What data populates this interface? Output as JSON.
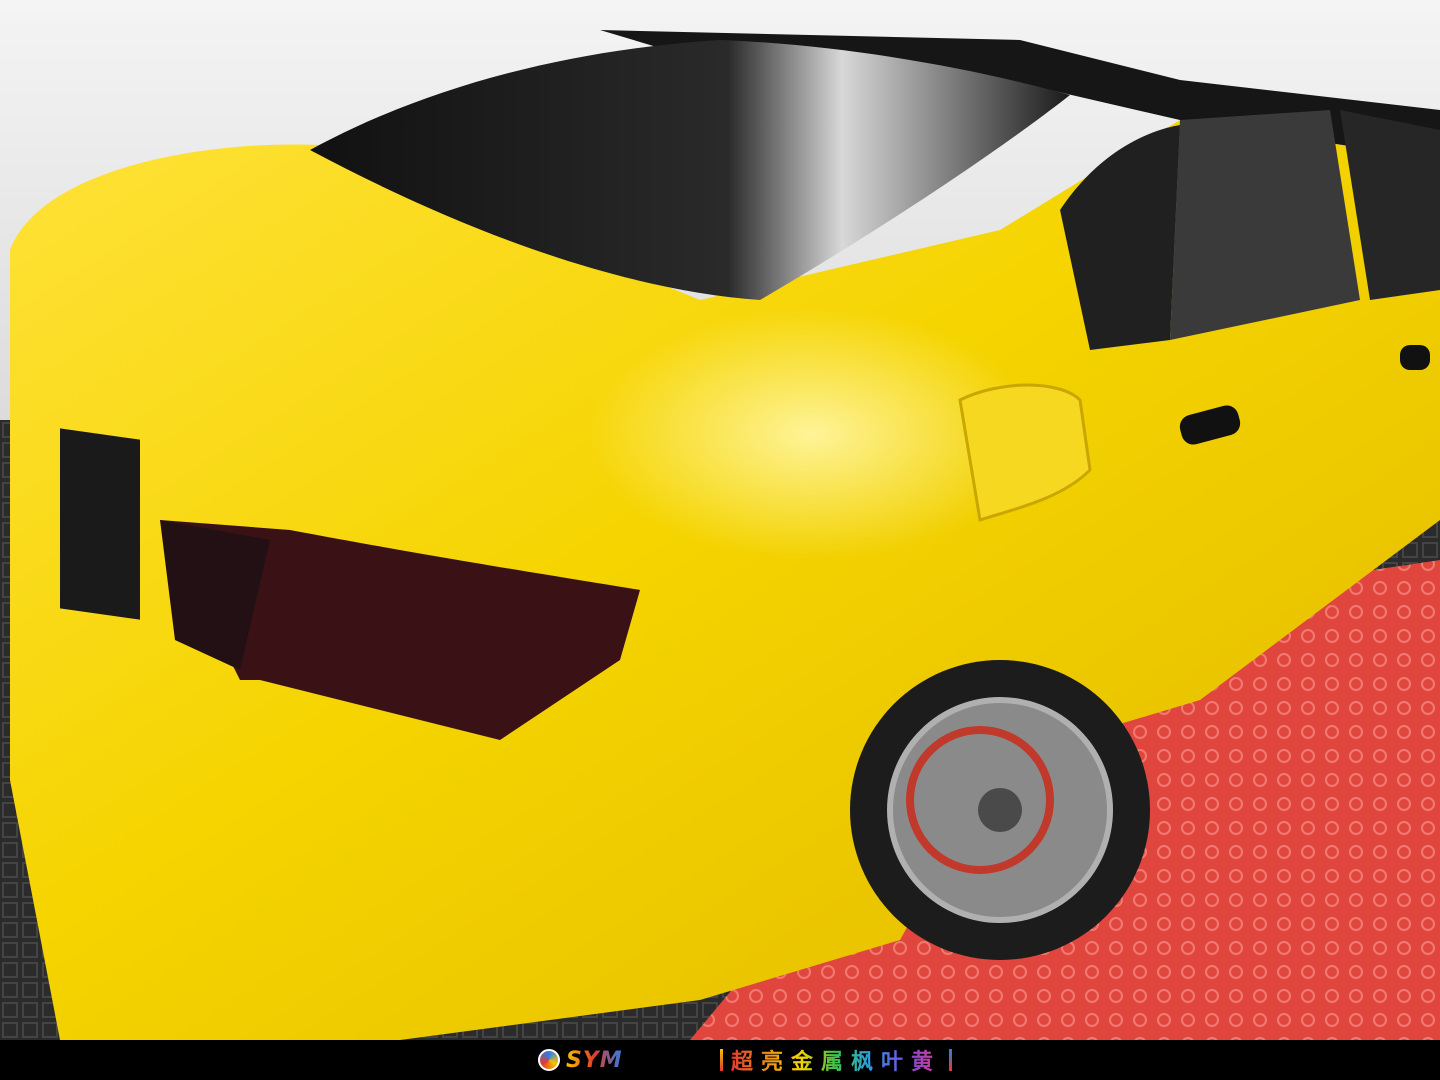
{
  "photo": {
    "subject": "yellow-wrapped-sedan",
    "colors": {
      "wrap_yellow": "#f5d400",
      "wrap_highlight": "#fff27a",
      "wrap_shadow": "#d9a800",
      "glass": "#1a1a1a",
      "taillight": "#3a1216",
      "wall": "#ececec",
      "floor_dark": "#2b2b2b",
      "floor_mat_red": "#e0463d",
      "wheel": "#8a8a8a"
    }
  },
  "footer": {
    "logo_text": "SYM",
    "caption": "超亮金属枫叶黄"
  }
}
